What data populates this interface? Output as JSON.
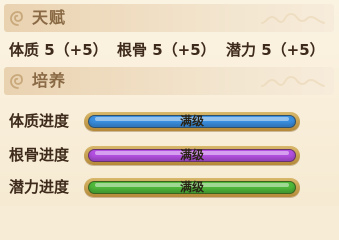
{
  "sections": {
    "talent": {
      "title": "天赋"
    },
    "training": {
      "title": "培养"
    }
  },
  "talents": [
    {
      "text": "体质 5（+5）"
    },
    {
      "text": "根骨 5（+5）"
    },
    {
      "text": "潜力 5（+5）"
    }
  ],
  "progress": [
    {
      "label": "体质进度",
      "status": "满级",
      "fraction": 1.0,
      "color": "#3a8fe0"
    },
    {
      "label": "根骨进度",
      "status": "满级",
      "fraction": 1.0,
      "color": "#b24fe0"
    },
    {
      "label": "潜力进度",
      "status": "满级",
      "fraction": 1.0,
      "color": "#4fb83a"
    }
  ],
  "icons": [
    "swirl-ornament-icon",
    "cloud-ornament-icon"
  ]
}
